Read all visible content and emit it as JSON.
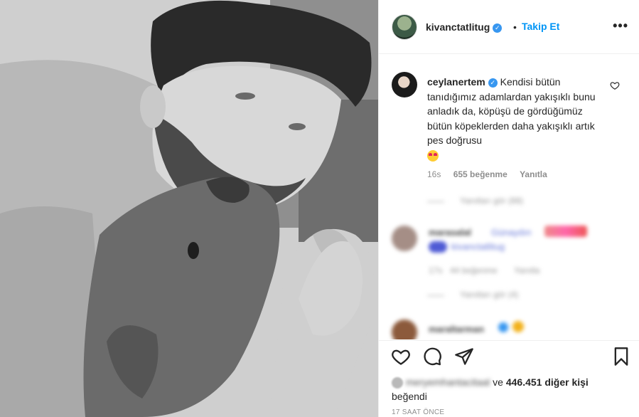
{
  "post": {
    "owner": {
      "username": "kivanctatlitug",
      "follow_label": "Takip Et",
      "dot": "•",
      "more": "•••",
      "verified_mark": "✓"
    },
    "photo": {
      "description_icon": "photo-icon"
    },
    "comment": {
      "username": "ceylanertem",
      "verified_mark": "✓",
      "text": "Kendisi bütün tanıdığımız adamlardan yakışıklı bunu anladık da, köpüşü de gördüğümüz bütün köpeklerden daha yakışıklı artık pes doğrusu",
      "time": "16s",
      "likes": "655 beğenme",
      "reply": "Yanıtla"
    },
    "blurred": {
      "view_replies_1": "Yanıtları gör (88)",
      "commenter_2": "marasalal",
      "comment_2": "Günaydın",
      "comment_2b": "kivanctatlitug",
      "meta_2_time": "17s",
      "meta_2_likes": "44 beğenme",
      "meta_2_reply": "Yanıtla",
      "view_replies_2": "Yanıtları gör (4)",
      "commenter_3": "maraltarman"
    },
    "likes": {
      "liker": "meryemhantacitaal",
      "connector": "ve",
      "count": "446.451 diğer kişi",
      "suffix": "beğendi"
    },
    "timestamp": "17 SAAT ÖNCE"
  },
  "colors": {
    "link_blue": "#0095f6",
    "verified_blue": "#3897f0",
    "muted": "#8e8e8e",
    "text": "#262626"
  }
}
